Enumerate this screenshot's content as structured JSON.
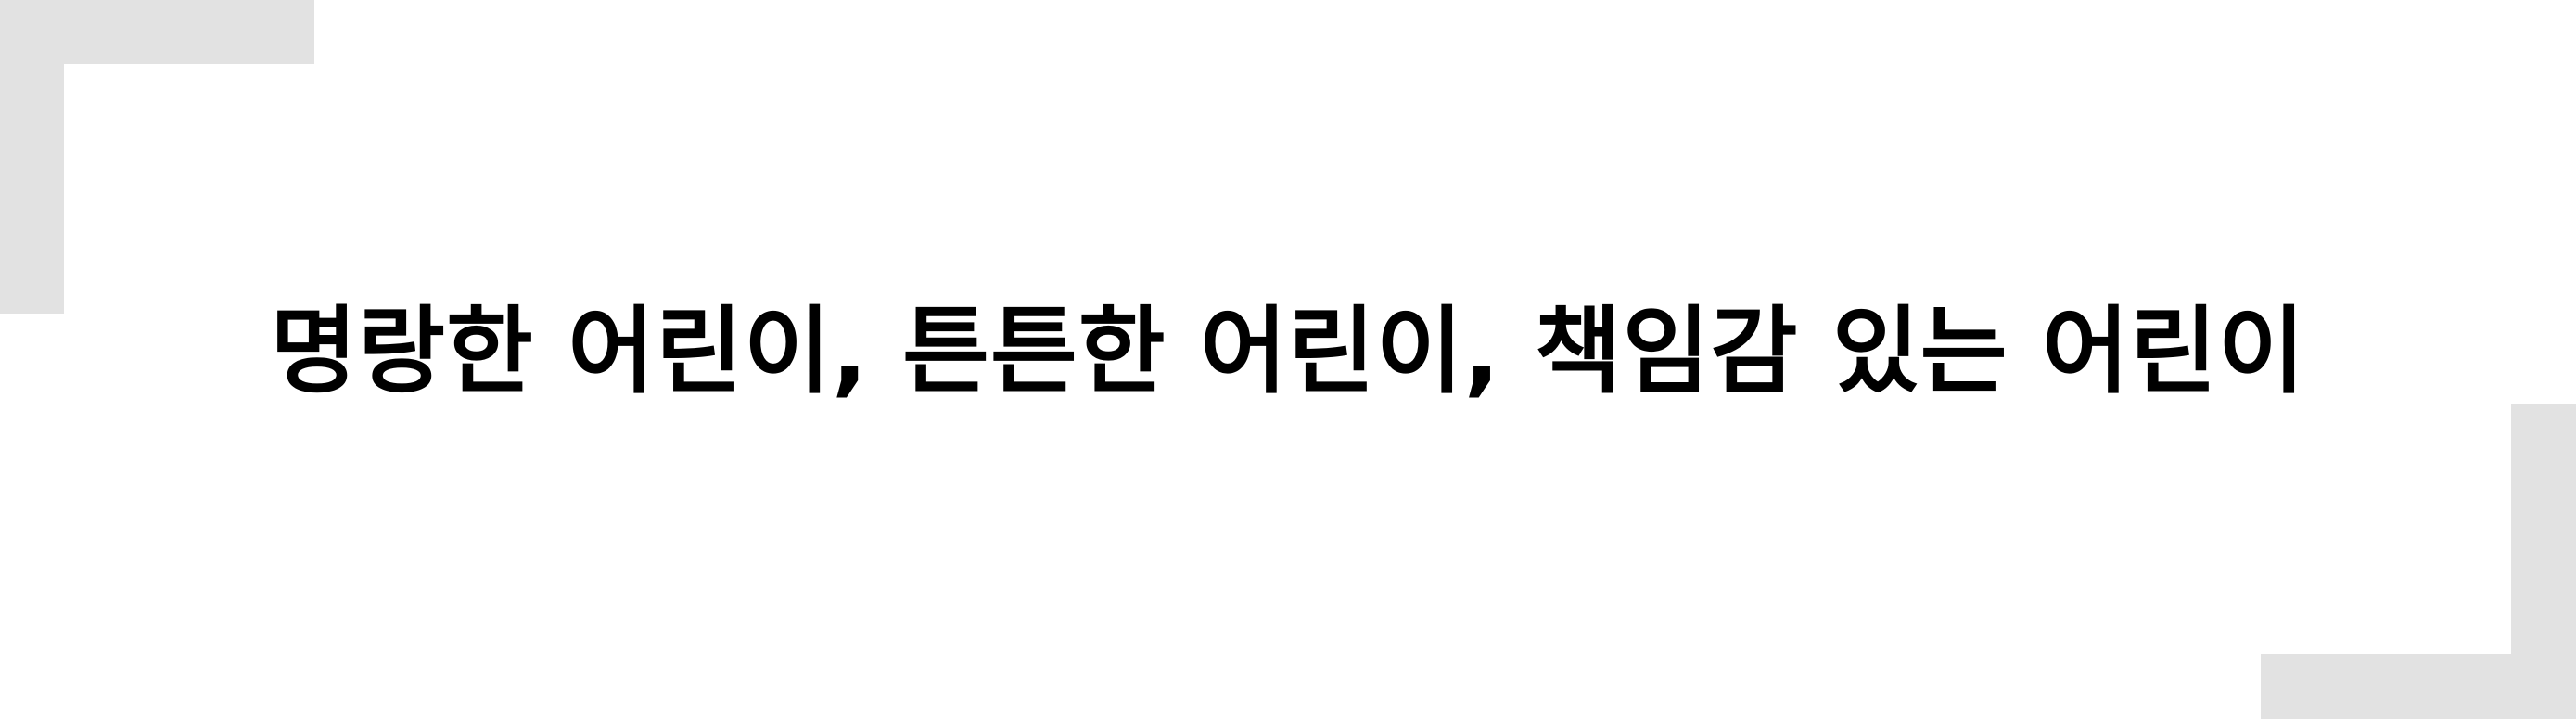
{
  "slogan": "명랑한 어린이, 튼튼한 어린이, 책임감 있는 어린이",
  "colors": {
    "background": "#ffffff",
    "text": "#000000",
    "bracket": "#e2e2e2"
  }
}
